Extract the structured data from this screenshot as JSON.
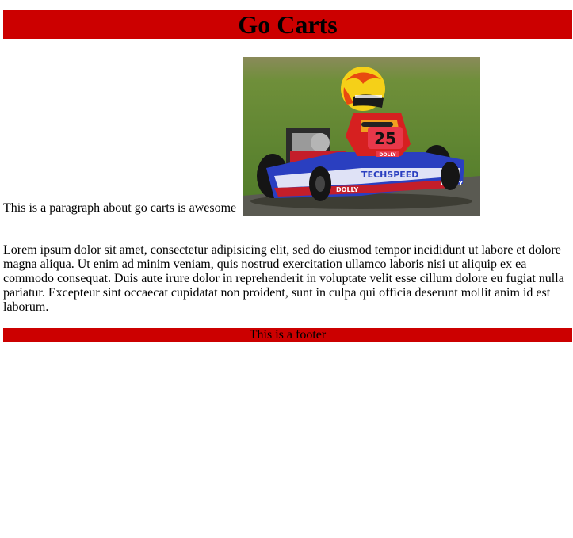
{
  "header": {
    "title": "Go Carts"
  },
  "intro": {
    "paragraph": "This is a paragraph about go carts is awesome"
  },
  "image": {
    "subject": "go-kart-racer-photo",
    "kart_number": "25",
    "sponsor_text": "TECHSPEED",
    "side_text": "DOLLY"
  },
  "lorem": {
    "text": "Lorem ipsum dolor sit amet, consectetur adipisicing elit, sed do eiusmod tempor incididunt ut labore et dolore magna aliqua. Ut enim ad minim veniam, quis nostrud exercitation ullamco laboris nisi ut aliquip ex ea commodo consequat. Duis aute irure dolor in reprehenderit in voluptate velit esse cillum dolore eu fugiat nulla pariatur. Excepteur sint occaecat cupidatat non proident, sunt in culpa qui officia deserunt mollit anim id est laborum."
  },
  "footer": {
    "text": "This is a footer"
  },
  "colors": {
    "banner": "#cc0000",
    "text": "#000000",
    "background": "#ffffff"
  }
}
